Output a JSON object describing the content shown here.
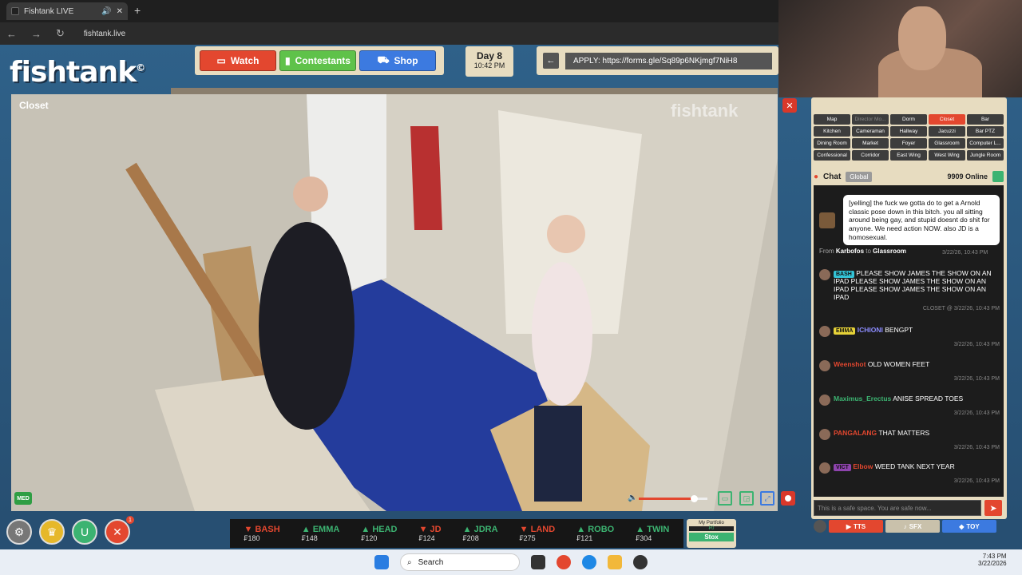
{
  "browser": {
    "tab_title": "Fishtank LIVE",
    "url": "fishtank.live"
  },
  "site": {
    "logo": "fishtank",
    "logo_mark": "©",
    "nav": {
      "watch": "Watch",
      "contestants": "Contestants",
      "shop": "Shop"
    },
    "day": {
      "label": "Day 8",
      "time": "10:42 PM"
    },
    "apply": "APPLY: https://forms.gle/Sq89p6NKjmgf7NiH8"
  },
  "video": {
    "room": "Closet",
    "watermark": "fishtank",
    "quality": "MED",
    "volume": 0.8
  },
  "rooms": [
    {
      "label": "Map"
    },
    {
      "label": "Director Mo..."
    },
    {
      "label": "Dorm"
    },
    {
      "label": "Closet",
      "selected": true
    },
    {
      "label": "Bar"
    },
    {
      "label": "Kitchen"
    },
    {
      "label": "Cameraman"
    },
    {
      "label": "Hallway"
    },
    {
      "label": "Jacuzzi"
    },
    {
      "label": "Bar PTZ"
    },
    {
      "label": "Dining Room"
    },
    {
      "label": "Market"
    },
    {
      "label": "Foyer"
    },
    {
      "label": "Glassroom"
    },
    {
      "label": "Computer L..."
    },
    {
      "label": "Confessional"
    },
    {
      "label": "Corridor"
    },
    {
      "label": "East Wing"
    },
    {
      "label": "West Wing"
    },
    {
      "label": "Jungle Room"
    }
  ],
  "chat": {
    "title": "Chat",
    "scope": "Global",
    "online": "9909 Online",
    "tts": {
      "text": "[yelling] the fuck we gotta do to get a Arnold classic pose down in this bitch. you all sitting around being gay, and stupid doesnt do shit for anyone. We need action NOW. also JD is a homosexual.",
      "from_prefix": "From",
      "from": "Karbofos",
      "to_prefix": "to",
      "to": "Glassroom",
      "time": "3/22/26, 10:43 PM"
    },
    "messages": [
      {
        "badge": "BASH",
        "badge_color": "#33c3d6",
        "user": "",
        "user_color": "#000000",
        "text": "PLEASE SHOW JAMES THE SHOW ON AN IPAD PLEASE SHOW JAMES THE SHOW ON AN IPAD PLEASE SHOW JAMES THE SHOW ON AN IPAD",
        "time": "CLOSET @ 3/22/26, 10:43 PM"
      },
      {
        "badge": "EMMA",
        "badge_color": "#e6d238",
        "user": "ICHIONI",
        "user_color": "#8c8cff",
        "text": "BENGPT",
        "time": "3/22/26, 10:43 PM"
      },
      {
        "badge": "",
        "badge_color": "",
        "user": "Weenshot",
        "user_color": "#e3472f",
        "text": "OLD WOMEN FEET",
        "time": "3/22/26, 10:43 PM"
      },
      {
        "badge": "",
        "badge_color": "",
        "user": "Maximus_Erectus",
        "user_color": "#3cb371",
        "text": "ANISE SPREAD TOES",
        "time": "3/22/26, 10:43 PM"
      },
      {
        "badge": "",
        "badge_color": "",
        "user": "PANGALANG",
        "user_color": "#e3472f",
        "text": "THAT MATTERS",
        "time": "3/22/26, 10:43 PM"
      },
      {
        "badge": "VICT",
        "badge_color": "#8e44ad",
        "user": "Elbow",
        "user_color": "#e3472f",
        "text": "WEED TANK NEXT YEAR",
        "time": "3/22/26, 10:43 PM"
      }
    ],
    "input_placeholder": "This is a safe space. You are safe now...",
    "buttons": {
      "tts": "TTS",
      "sfx": "SFX",
      "toy": "TOY"
    }
  },
  "ticker": [
    {
      "name": "BASH",
      "price": "₣180",
      "dir": "down"
    },
    {
      "name": "EMMA",
      "price": "₣148",
      "dir": "up"
    },
    {
      "name": "HEAD",
      "price": "₣120",
      "dir": "up"
    },
    {
      "name": "JD",
      "price": "₣124",
      "dir": "down"
    },
    {
      "name": "JDRA",
      "price": "₣208",
      "dir": "up"
    },
    {
      "name": "LAND",
      "price": "₣275",
      "dir": "down"
    },
    {
      "name": "ROBO",
      "price": "₣121",
      "dir": "up"
    },
    {
      "name": "TWIN",
      "price": "₣304",
      "dir": "up"
    }
  ],
  "portfolio": {
    "label": "My Portfolio",
    "value": "₣0",
    "button": "Stox"
  },
  "notifications": "1",
  "taskbar": {
    "search": "Search",
    "time": "7:43 PM",
    "date": "3/22/2026"
  },
  "colors": {
    "accent_red": "#e3472f",
    "accent_green": "#5fc24a",
    "accent_blue": "#3c7ae0",
    "panel": "#e7dcc0"
  }
}
